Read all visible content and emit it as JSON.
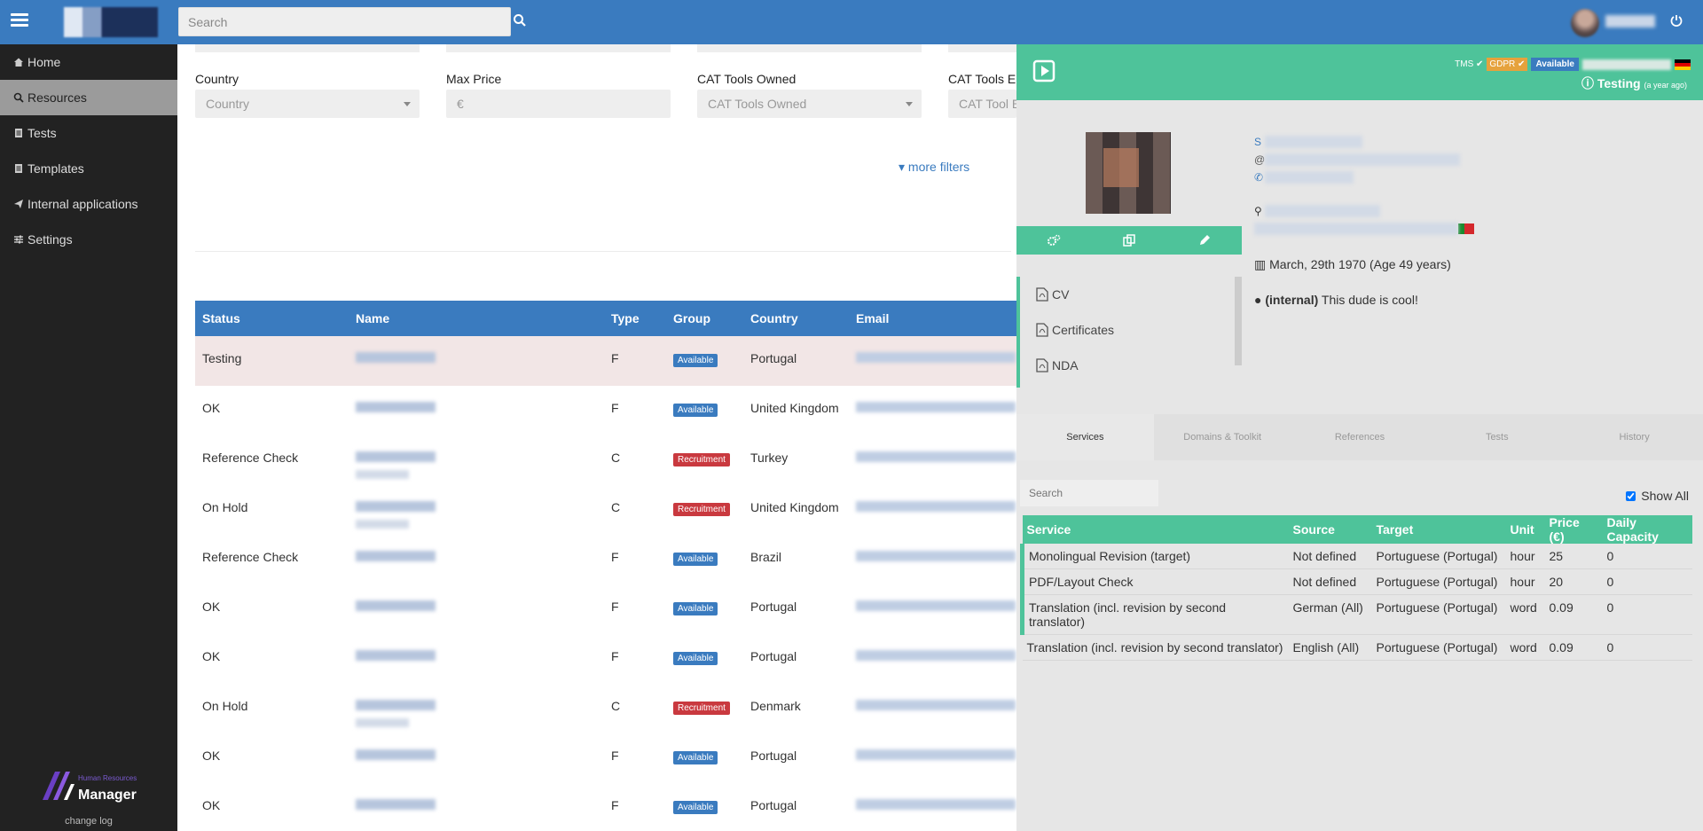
{
  "topbar": {
    "search_placeholder": "Search"
  },
  "sidebar": {
    "items": [
      {
        "label": "Home",
        "icon": "home-icon"
      },
      {
        "label": "Resources",
        "icon": "search-icon"
      },
      {
        "label": "Tests",
        "icon": "document-icon"
      },
      {
        "label": "Templates",
        "icon": "document-icon"
      },
      {
        "label": "Internal applications",
        "icon": "send-icon"
      },
      {
        "label": "Settings",
        "icon": "sliders-icon"
      }
    ],
    "brand_small": "Human Resources",
    "brand_big": "Manager",
    "changelog": "change log"
  },
  "filters": {
    "country_label": "Country",
    "country_placeholder": "Country",
    "maxprice_label": "Max Price",
    "maxprice_placeholder": "€",
    "cat_owned_label": "CAT Tools Owned",
    "cat_owned_placeholder": "CAT Tools Owned",
    "cat_exp_label": "CAT Tools E",
    "cat_exp_placeholder": "CAT Tool E",
    "more_filters": "more filters"
  },
  "table": {
    "headers": [
      "Status",
      "Name",
      "Type",
      "Group",
      "Country",
      "Email"
    ],
    "rows": [
      {
        "status": "Testing",
        "type": "F",
        "group": "Available",
        "group_kind": "available",
        "country": "Portugal"
      },
      {
        "status": "OK",
        "type": "F",
        "group": "Available",
        "group_kind": "available",
        "country": "United Kingdom"
      },
      {
        "status": "Reference Check",
        "type": "C",
        "group": "Recruitment",
        "group_kind": "recruitment",
        "country": "Turkey"
      },
      {
        "status": "On Hold",
        "type": "C",
        "group": "Recruitment",
        "group_kind": "recruitment",
        "country": "United Kingdom"
      },
      {
        "status": "Reference Check",
        "type": "F",
        "group": "Available",
        "group_kind": "available",
        "country": "Brazil"
      },
      {
        "status": "OK",
        "type": "F",
        "group": "Available",
        "group_kind": "available",
        "country": "Portugal"
      },
      {
        "status": "OK",
        "type": "F",
        "group": "Available",
        "group_kind": "available",
        "country": "Portugal"
      },
      {
        "status": "On Hold",
        "type": "C",
        "group": "Recruitment",
        "group_kind": "recruitment",
        "country": "Denmark"
      },
      {
        "status": "OK",
        "type": "F",
        "group": "Available",
        "group_kind": "available",
        "country": "Portugal"
      },
      {
        "status": "OK",
        "type": "F",
        "group": "Available",
        "group_kind": "available",
        "country": "Portugal"
      }
    ]
  },
  "panel": {
    "tags": {
      "tms": "TMS ✔",
      "gdpr": "GDPR ✔",
      "available": "Available"
    },
    "status": "Testing",
    "status_ago": "(a year ago)",
    "docs": [
      "CV",
      "Certificates",
      "NDA"
    ],
    "birth": "March, 29th 1970 (Age 49 years)",
    "note_prefix": "(internal)",
    "note_text": "This dude is cool!",
    "tabs": [
      "Services",
      "Domains & Toolkit",
      "References",
      "Tests",
      "History"
    ],
    "services_search_placeholder": "Search",
    "show_all": "Show All",
    "services_headers": [
      "Service",
      "Source",
      "Target",
      "Unit",
      "Price (€)",
      "Daily Capacity"
    ],
    "services": [
      {
        "service": "Monolingual Revision (target)",
        "source": "Not defined",
        "target": "Portuguese (Portugal)",
        "unit": "hour",
        "price": "25",
        "capacity": "0"
      },
      {
        "service": "PDF/Layout Check",
        "source": "Not defined",
        "target": "Portuguese (Portugal)",
        "unit": "hour",
        "price": "20",
        "capacity": "0"
      },
      {
        "service": "Translation (incl. revision by second translator)",
        "source": "German (All)",
        "target": "Portuguese (Portugal)",
        "unit": "word",
        "price": "0.09",
        "capacity": "0"
      },
      {
        "service": "Translation (incl. revision by second translator)",
        "source": "English (All)",
        "target": "Portuguese (Portugal)",
        "unit": "word",
        "price": "0.09",
        "capacity": "0"
      }
    ]
  },
  "colors": {
    "primary": "#3a7bbf",
    "panel_accent": "#4ec39a",
    "recruitment": "#c9393f",
    "gdpr": "#e6a23c"
  }
}
